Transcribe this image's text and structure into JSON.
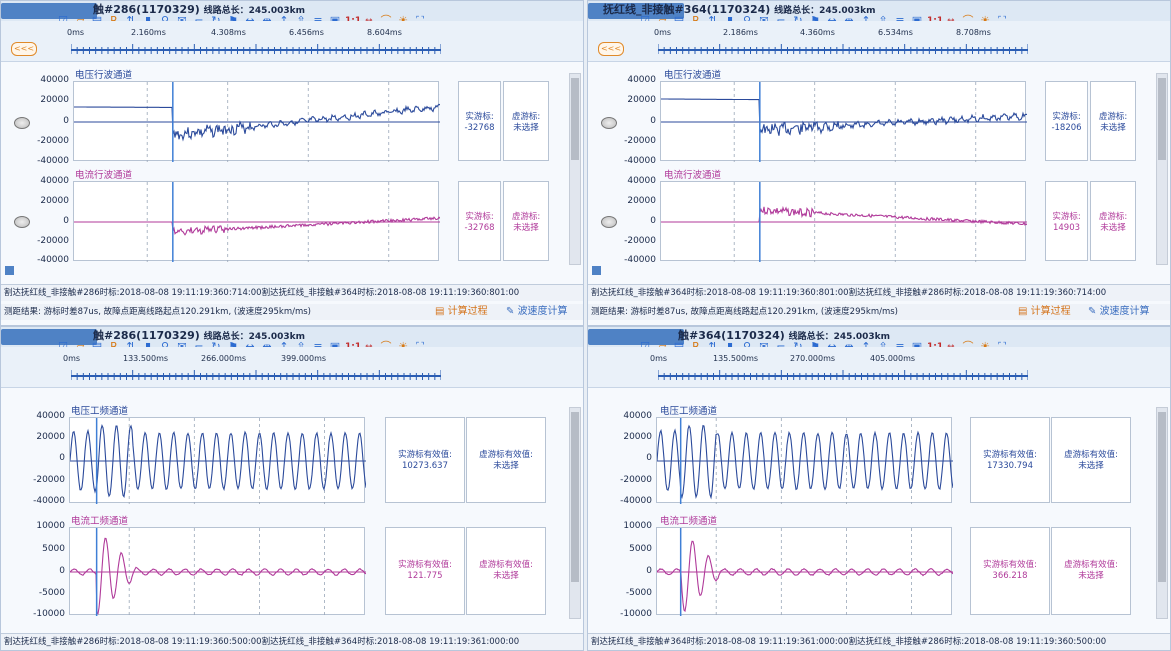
{
  "panels": [
    {
      "title": "触#286(1170329)",
      "title_suffix": "线路总长：245.003km",
      "time_labels": [
        "0ms",
        "2.160ms",
        "4.308ms",
        "6.456ms",
        "8.604ms"
      ],
      "channels": [
        {
          "name": "电压行波通道",
          "color": "#2b4a9b",
          "yticks": [
            "40000",
            "20000",
            "0",
            "-20000",
            "-40000"
          ],
          "real_label": "实游标:",
          "real_value": "-32768",
          "virt_label": "虚游标:",
          "virt_value": "未选择"
        },
        {
          "name": "电流行波通道",
          "color": "#b03a9a",
          "yticks": [
            "40000",
            "20000",
            "0",
            "-20000",
            "-40000"
          ],
          "real_label": "实游标:",
          "real_value": "-32768",
          "virt_label": "虚游标:",
          "virt_value": "未选择"
        }
      ],
      "info_line": "割达抚红线_非接触#286时标:2018-08-08 19:11:19:360:714:00割达抚红线_非接触#364时标:2018-08-08 19:11:19:360:801:00",
      "result_line": "测距结果: 游标时差87us, 故障点距离线路起点120.291km, (波速度295km/ms)",
      "btn_calc": "计算过程",
      "btn_speed": "波速度计算"
    },
    {
      "title": "抚红线_非接触#364(1170324)",
      "title_suffix": "线路总长：245.003km",
      "time_labels": [
        "0ms",
        "2.186ms",
        "4.360ms",
        "6.534ms",
        "8.708ms"
      ],
      "channels": [
        {
          "name": "电压行波通道",
          "color": "#2b4a9b",
          "yticks": [
            "40000",
            "20000",
            "0",
            "-20000",
            "-40000"
          ],
          "real_label": "实游标:",
          "real_value": "-18206",
          "virt_label": "虚游标:",
          "virt_value": "未选择"
        },
        {
          "name": "电流行波通道",
          "color": "#b03a9a",
          "yticks": [
            "40000",
            "20000",
            "0",
            "-20000",
            "-40000"
          ],
          "real_label": "实游标:",
          "real_value": "14903",
          "virt_label": "虚游标:",
          "virt_value": "未选择"
        }
      ],
      "info_line": "割达抚红线_非接触#364时标:2018-08-08 19:11:19:360:801:00割达抚红线_非接触#286时标:2018-08-08 19:11:19:360:714:00",
      "result_line": "测距结果: 游标时差87us, 故障点距离线路起点120.291km, (波速度295km/ms)",
      "btn_calc": "计算过程",
      "btn_speed": "波速度计算"
    },
    {
      "title": "触#286(1170329)",
      "title_suffix": "线路总长：245.003km",
      "time_labels": [
        "0ms",
        "133.500ms",
        "266.000ms",
        "399.000ms"
      ],
      "channels": [
        {
          "name": "电压工频通道",
          "color": "#2b4a9b",
          "yticks": [
            "40000",
            "20000",
            "0",
            "-20000",
            "-40000"
          ],
          "real_label": "实游标有效值:",
          "real_value": "10273.637",
          "virt_label": "虚游标有效值:",
          "virt_value": "未选择"
        },
        {
          "name": "电流工频通道",
          "color": "#b03a9a",
          "yticks": [
            "10000",
            "5000",
            "0",
            "-5000",
            "-10000"
          ],
          "real_label": "实游标有效值:",
          "real_value": "121.775",
          "virt_label": "虚游标有效值:",
          "virt_value": "未选择"
        }
      ],
      "info_line": "割达抚红线_非接触#286时标:2018-08-08 19:11:19:360:500:00割达抚红线_非接触#364时标:2018-08-08 19:11:19:361:000:00"
    },
    {
      "title": "触#364(1170324)",
      "title_suffix": "线路总长：245.003km",
      "time_labels": [
        "0ms",
        "135.500ms",
        "270.000ms",
        "405.000ms"
      ],
      "channels": [
        {
          "name": "电压工频通道",
          "color": "#2b4a9b",
          "yticks": [
            "40000",
            "20000",
            "0",
            "-20000",
            "-40000"
          ],
          "real_label": "实游标有效值:",
          "real_value": "17330.794",
          "virt_label": "虚游标有效值:",
          "virt_value": "未选择"
        },
        {
          "name": "电流工频通道",
          "color": "#b03a9a",
          "yticks": [
            "10000",
            "5000",
            "0",
            "-5000",
            "-10000"
          ],
          "real_label": "实游标有效值:",
          "real_value": "366.218",
          "virt_label": "虚游标有效值:",
          "virt_value": "未选择"
        }
      ],
      "info_line": "割达抚红线_非接触#364时标:2018-08-08 19:11:19:361:000:00割达抚红线_非接触#286时标:2018-08-08 19:11:19:360:500:00"
    }
  ],
  "toolbar_icons": [
    "check-icon",
    "open-icon",
    "list-icon",
    "r-icon",
    "sort-icon",
    "bar-icon",
    "filter-icon",
    "envelope-icon",
    "crop-icon",
    "loop-icon",
    "flag-icon",
    "expand-h-icon",
    "shrink-h-icon",
    "expand-v-icon",
    "shrink-v-icon",
    "align-icon",
    "save-icon",
    "one-to-one-icon",
    "fit-icon",
    "hat-icon",
    "sun-icon",
    "fullscreen-icon"
  ],
  "toolbar_label_1to1": "1:1",
  "chev_label": "<<<"
}
